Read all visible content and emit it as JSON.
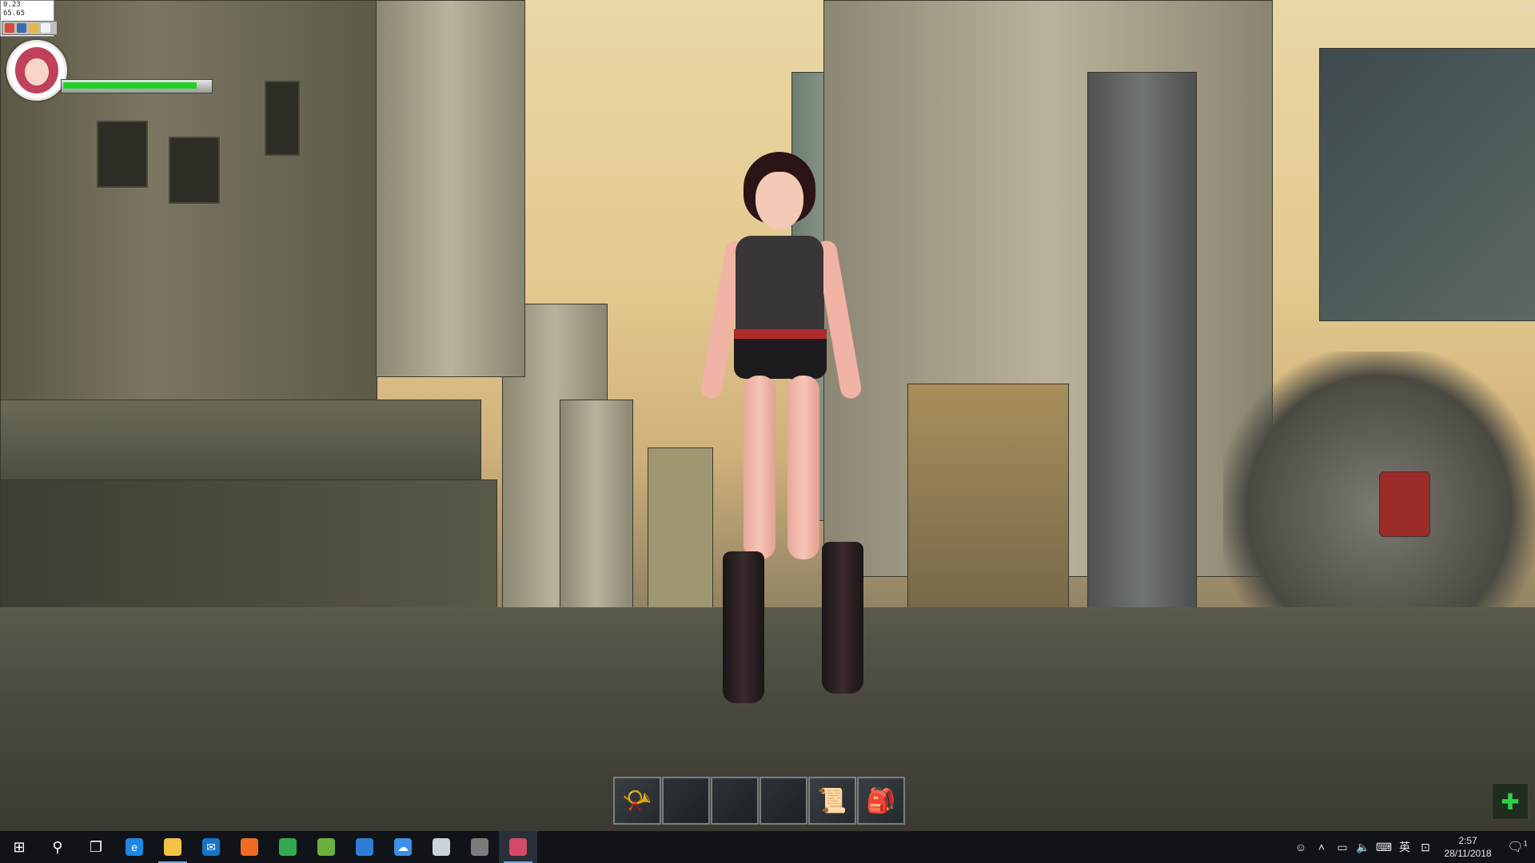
{
  "hud": {
    "stats_line1": "0.23",
    "stats_line2": "65.65",
    "health_fraction": 0.92
  },
  "hotbar": {
    "slots": [
      {
        "item": "phonograph",
        "glyph": "📯"
      },
      {
        "item": "empty",
        "glyph": ""
      },
      {
        "item": "empty",
        "glyph": ""
      },
      {
        "item": "empty",
        "glyph": ""
      },
      {
        "item": "map-scroll",
        "glyph": "📜"
      },
      {
        "item": "backpack",
        "glyph": "🎒"
      }
    ]
  },
  "taskbar": {
    "start_glyph": "⊞",
    "search_glyph": "⚲",
    "taskview_glyph": "❐",
    "apps": [
      {
        "name": "edge",
        "color": "#1e88e5",
        "glyph": "e",
        "active": false
      },
      {
        "name": "file-explorer",
        "color": "#f3c244",
        "glyph": "",
        "active": true
      },
      {
        "name": "mail",
        "color": "#1b73c7",
        "glyph": "✉",
        "active": false
      },
      {
        "name": "firefox",
        "color": "#ef6b22",
        "glyph": "",
        "active": false
      },
      {
        "name": "chrome",
        "color": "#34a853",
        "glyph": "",
        "active": false
      },
      {
        "name": "notepad",
        "color": "#6bb13b",
        "glyph": "",
        "active": false
      },
      {
        "name": "cortana",
        "color": "#2e7ed6",
        "glyph": "",
        "active": false
      },
      {
        "name": "cloud-drive",
        "color": "#3d8ee6",
        "glyph": "☁",
        "active": false
      },
      {
        "name": "remote",
        "color": "#c8d3dc",
        "glyph": "",
        "active": false
      },
      {
        "name": "game-tool",
        "color": "#7b7b7b",
        "glyph": "",
        "active": false
      },
      {
        "name": "game-window",
        "color": "#d34b67",
        "glyph": "",
        "active": true,
        "current": true
      }
    ],
    "tray": {
      "ime": "英",
      "time": "2:57",
      "date": "28/11/2018",
      "notification_count": "1"
    }
  },
  "colors": {
    "health_bar": "#22d12a",
    "taskbar_bg": "#101418"
  }
}
